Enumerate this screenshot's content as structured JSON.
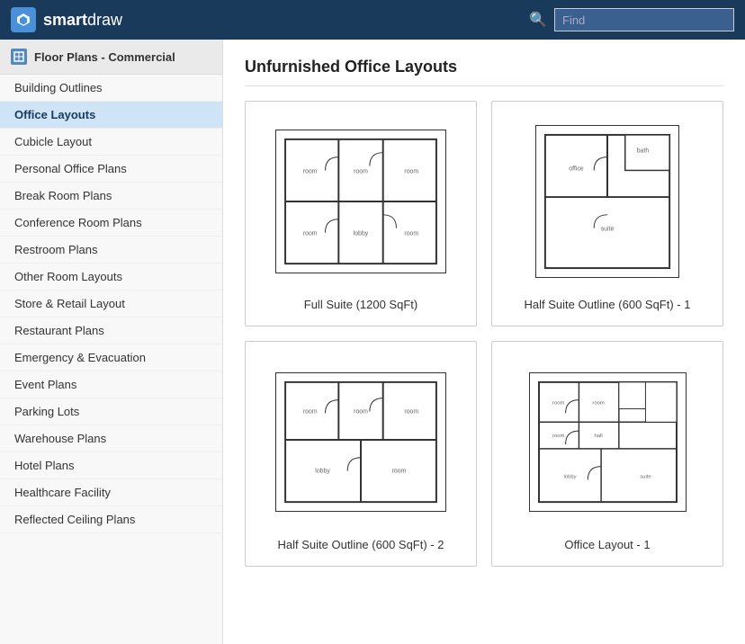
{
  "header": {
    "logo_smart": "smart",
    "logo_draw": "draw",
    "search_placeholder": "Find"
  },
  "sidebar": {
    "header_label": "Floor Plans - Commercial",
    "items": [
      {
        "label": "Building Outlines",
        "active": false
      },
      {
        "label": "Office Layouts",
        "active": true
      },
      {
        "label": "Cubicle Layout",
        "active": false
      },
      {
        "label": "Personal Office Plans",
        "active": false
      },
      {
        "label": "Break Room Plans",
        "active": false
      },
      {
        "label": "Conference Room Plans",
        "active": false
      },
      {
        "label": "Restroom Plans",
        "active": false
      },
      {
        "label": "Other Room Layouts",
        "active": false
      },
      {
        "label": "Store & Retail Layout",
        "active": false
      },
      {
        "label": "Restaurant Plans",
        "active": false
      },
      {
        "label": "Emergency & Evacuation",
        "active": false
      },
      {
        "label": "Event Plans",
        "active": false
      },
      {
        "label": "Parking Lots",
        "active": false
      },
      {
        "label": "Warehouse Plans",
        "active": false
      },
      {
        "label": "Hotel Plans",
        "active": false
      },
      {
        "label": "Healthcare Facility",
        "active": false
      },
      {
        "label": "Reflected Ceiling Plans",
        "active": false
      }
    ]
  },
  "content": {
    "title": "Unfurnished Office Layouts",
    "cards": [
      {
        "label": "Full Suite (1200 SqFt)",
        "id": "full-suite-1200"
      },
      {
        "label": "Half Suite Outline (600 SqFt) - 1",
        "id": "half-suite-600-1"
      },
      {
        "label": "Half Suite Outline (600 SqFt) - 2",
        "id": "half-suite-600-2"
      },
      {
        "label": "Office Layout - 1",
        "id": "office-layout-1"
      }
    ]
  }
}
